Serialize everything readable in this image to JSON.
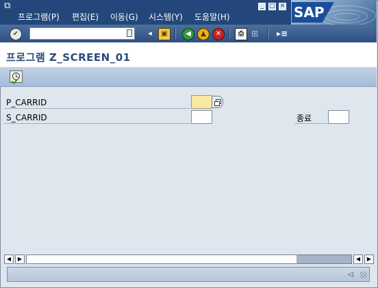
{
  "menubar": {
    "items": [
      "프로그램(P)",
      "편집(E)",
      "이동(G)",
      "시스템(Y)",
      "도움말(H)"
    ],
    "window_buttons": [
      "minimize-icon",
      "maximize-icon",
      "close-icon"
    ],
    "logo": "SAP"
  },
  "toolbar": {
    "command_field_value": "",
    "icons": [
      "enter-check-icon",
      "back-arrow-icon",
      "save-icon",
      "back-icon",
      "exit-icon",
      "cancel-icon",
      "print-icon",
      "find-icon",
      "new-session-icon"
    ]
  },
  "title": "프로그램 Z_SCREEN_01",
  "app_toolbar": {
    "execute_icon": "execute-clock-icon"
  },
  "form": {
    "p_carrid_label": "P_CARRID",
    "p_carrid_value": "",
    "s_carrid_label": "S_CARRID",
    "s_carrid_value": "",
    "end_label": "종료",
    "end_value": ""
  },
  "colors": {
    "menubar": "#23477a",
    "title_text": "#2b4b7a",
    "required_field": "#fbe7a4",
    "app_toolbar": "#b2c6de"
  }
}
